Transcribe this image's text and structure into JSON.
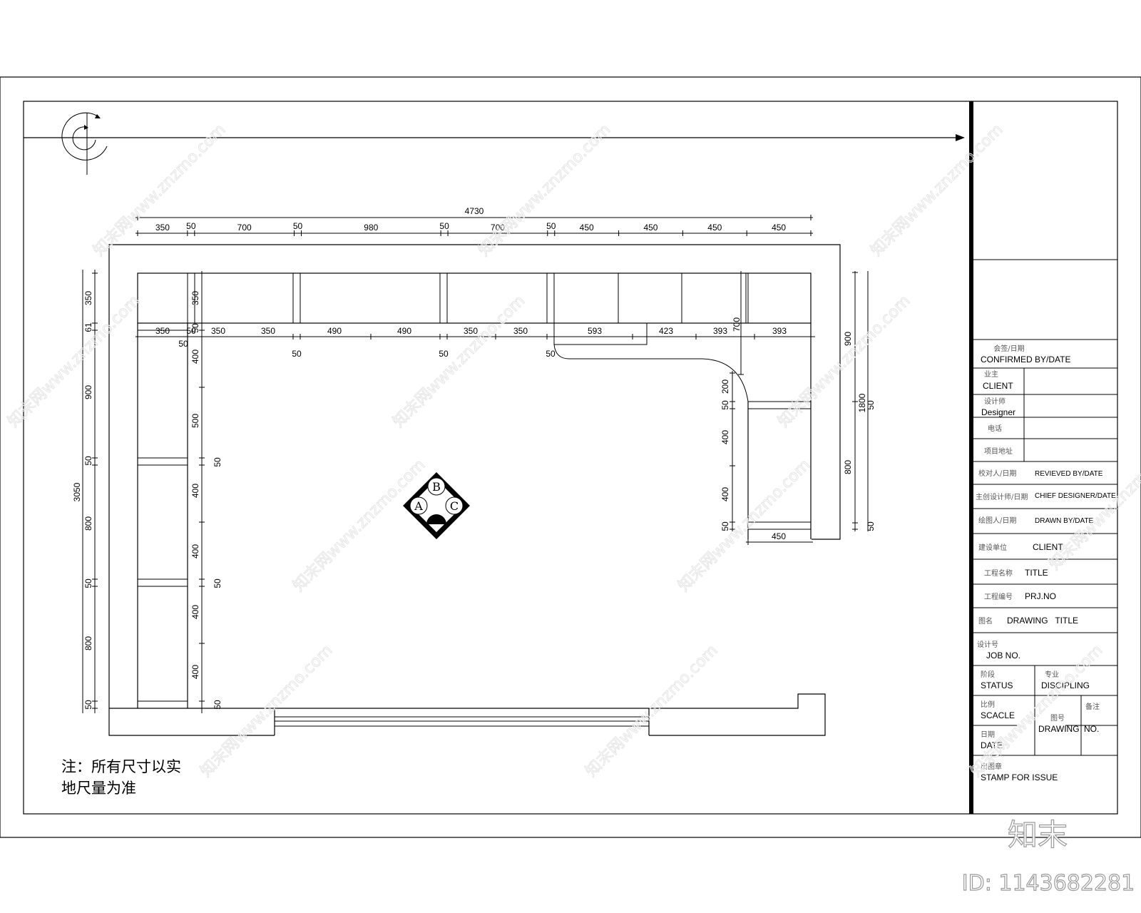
{
  "drawing": {
    "top_dimensions": {
      "overall": "4730",
      "segments": [
        "350",
        "50",
        "700",
        "50",
        "980",
        "50",
        "700",
        "50",
        "450",
        "450",
        "450",
        "450"
      ]
    },
    "inner_dimensions": {
      "segments": [
        "350",
        "50",
        "350",
        "350",
        "490",
        "490",
        "350",
        "350",
        "593",
        "423",
        "393",
        "393"
      ],
      "below_labels": [
        "50",
        "50",
        "50",
        "50"
      ],
      "corner_label": "700"
    },
    "left_dimensions": {
      "overall": "3050",
      "segments": [
        "350",
        "61",
        "900",
        "50",
        "800",
        "50",
        "800",
        "50"
      ]
    },
    "left_inner_dimensions": {
      "segments": [
        "350",
        "50",
        "400",
        "500",
        "50",
        "400",
        "400",
        "50",
        "400",
        "400",
        "50"
      ]
    },
    "right_dimensions": {
      "overall": "1800",
      "segments": [
        "900",
        "800",
        "50",
        "50"
      ]
    },
    "right_inner_dimensions": {
      "segments": [
        "200",
        "50",
        "400",
        "400",
        "50"
      ],
      "bottom": "450"
    },
    "index_symbol": {
      "top": "B",
      "left": "A",
      "right": "C"
    },
    "note_line1": "注：所有尺寸以实",
    "note_line2": "地尺量为准"
  },
  "title_block": {
    "confirmed_cn": "会签/日期",
    "confirmed": "CONFIRMED BY/DATE",
    "client_cn": "业主",
    "client": "CLIENT",
    "designer_cn": "设计师",
    "designer": "Designer",
    "phone_cn": "电话",
    "project_addr_cn": "项目地址",
    "reviewed_cn": "校对人/日期",
    "reviewed": "REVIEVED BY/DATE",
    "chief_cn": "主创设计师/日期",
    "chief": "CHIEF DESIGNER/DATE",
    "drawn_cn": "绘图人/日期",
    "drawn": "DRAWN BY/DATE",
    "build_unit_cn": "建设单位",
    "build_unit": "CLIENT",
    "proj_name_cn": "工程名称",
    "proj_name": "TITLE",
    "proj_no_cn": "工程编号",
    "proj_no": "PRJ.NO",
    "drawing_name_cn": "图名",
    "drawing_name": "DRAWING   TITLE",
    "job_cn": "设计号",
    "job": "JOB  NO.",
    "status_cn": "阶段",
    "status": "STATUS",
    "discipline_cn": "专业",
    "discipline": "DISCIPLING",
    "scale_cn": "比例",
    "scale": "SCACLE",
    "drawing_no_cn": "图号",
    "drawing_no": "DRAWING",
    "no_cn": "备注",
    "no": "NO.",
    "date_cn": "日期",
    "date": "DATE",
    "stamp_cn": "出图章",
    "stamp": "STAMP  FOR  ISSUE"
  },
  "watermark": {
    "text": "知末网www.znzmo.com",
    "brand": "知末",
    "id": "ID: 1143682281"
  }
}
